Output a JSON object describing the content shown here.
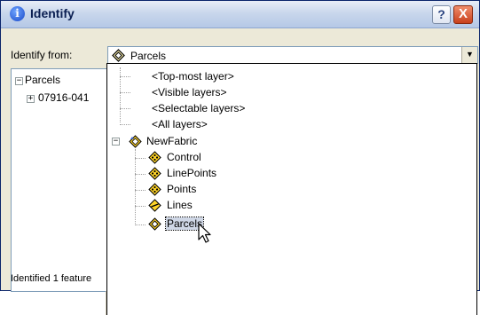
{
  "window": {
    "title": "Identify",
    "title_icon": "info-icon",
    "help_button": "?",
    "close_button": "X"
  },
  "identify_from": {
    "label": "Identify from:",
    "selected": "Parcels"
  },
  "results_tree": {
    "root": "Parcels",
    "child": "07916-041"
  },
  "status_text": "Identified 1 feature",
  "dropdown": {
    "options": [
      "<Top-most layer>",
      "<Visible layers>",
      "<Selectable layers>",
      "<All layers>"
    ],
    "group": "NewFabric",
    "layers": [
      "Control",
      "LinePoints",
      "Points",
      "Lines",
      "Parcels"
    ],
    "selected_layer": "Parcels"
  },
  "colors": {
    "titlebar": "#c9d7ec",
    "dialog_background": "#ece9d8",
    "close_button": "#c8401c",
    "layer_icon_fill": "#ffd428",
    "selection_highlight": "#cfd7e6"
  }
}
